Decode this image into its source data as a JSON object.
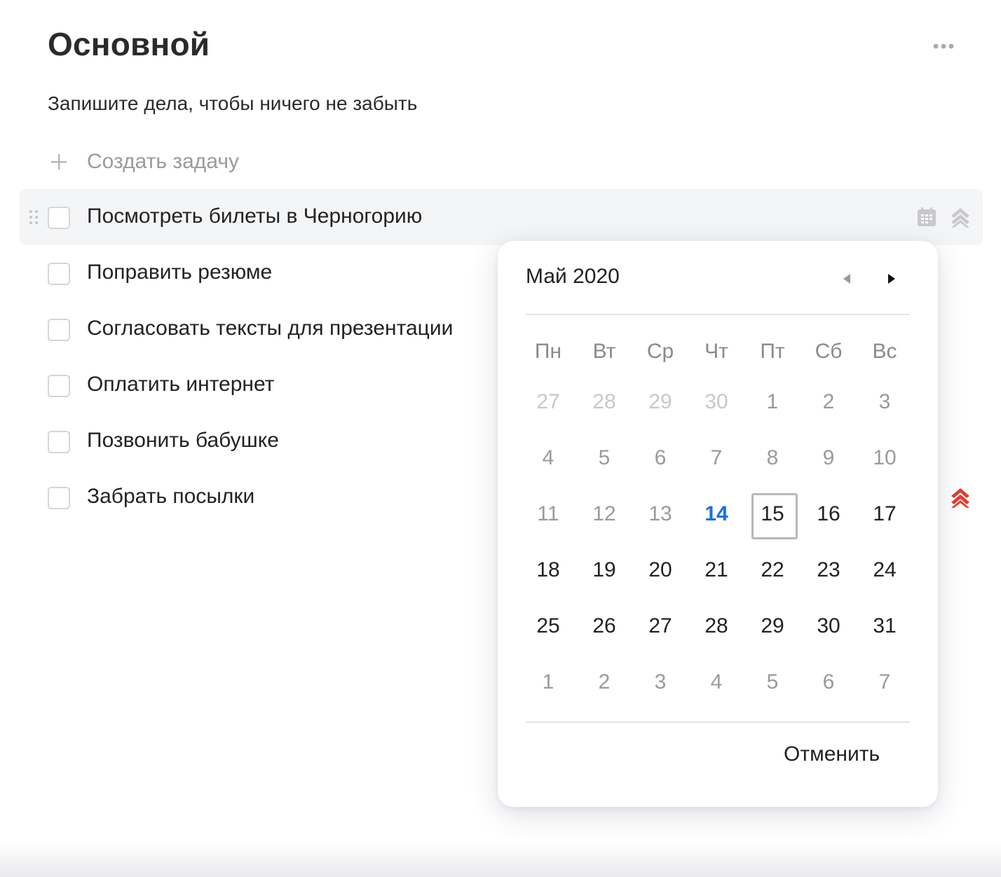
{
  "page": {
    "title": "Основной",
    "subtitle": "Запишите дела, чтобы ничего не забыть",
    "create_task_label": "Создать задачу"
  },
  "tasks": [
    {
      "text": "Посмотреть билеты в Черногорию",
      "hovered": true
    },
    {
      "text": "Поправить резюме"
    },
    {
      "text": "Согласовать тексты для презентации"
    },
    {
      "text": "Оплатить интернет"
    },
    {
      "text": "Позвонить бабушке"
    },
    {
      "text": "Забрать посылки",
      "priority_color": "#e23b2e"
    }
  ],
  "calendar": {
    "month_label": "Май 2020",
    "weekdays": [
      "Пн",
      "Вт",
      "Ср",
      "Чт",
      "Пт",
      "Сб",
      "Вс"
    ],
    "today": "14",
    "selected": "15",
    "today_color": "#1a6fe0",
    "weeks": [
      [
        "27",
        "28",
        "29",
        "30",
        "1",
        "2",
        "3"
      ],
      [
        "4",
        "5",
        "6",
        "7",
        "8",
        "9",
        "10"
      ],
      [
        "11",
        "12",
        "13",
        "14",
        "15",
        "16",
        "17"
      ],
      [
        "18",
        "19",
        "20",
        "21",
        "22",
        "23",
        "24"
      ],
      [
        "25",
        "26",
        "27",
        "28",
        "29",
        "30",
        "31"
      ],
      [
        "1",
        "2",
        "3",
        "4",
        "5",
        "6",
        "7"
      ]
    ],
    "cancel_label": "Отменить"
  },
  "icons": {
    "more": "more-horizontal-icon",
    "plus": "plus-icon",
    "drag": "drag-handle-icon",
    "calendar": "calendar-icon",
    "priority": "priority-chevrons-icon",
    "prev": "triangle-left-icon",
    "next": "triangle-right-icon"
  }
}
